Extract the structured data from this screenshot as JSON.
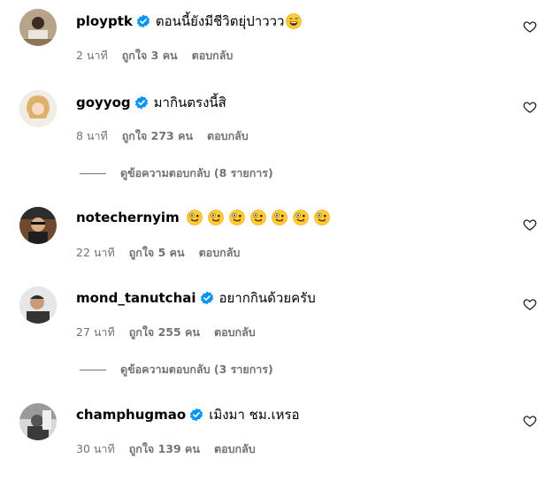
{
  "comments": [
    {
      "username": "ployptk",
      "verified": true,
      "text": "ตอนนี้ยังมีชีวิตยุ่ปาววว",
      "emoji_icons": [
        "laughing-sweat-emoji"
      ],
      "time": "2 นาที",
      "likes": "ถูกใจ 3 คน",
      "reply": "ตอบกลับ",
      "view_replies": ""
    },
    {
      "username": "goyyog",
      "verified": true,
      "text": "มากินตรงนี้สิ",
      "emoji_icons": [],
      "time": "8 นาที",
      "likes": "ถูกใจ 273 คน",
      "reply": "ตอบกลับ",
      "view_replies": "ดูข้อความตอบกลับ (8 รายการ)"
    },
    {
      "username": "notechernyim",
      "verified": false,
      "text": "",
      "emoji_icons": [
        "zany-face-emoji",
        "zany-face-emoji",
        "zany-face-emoji",
        "zany-face-emoji",
        "zany-face-emoji",
        "zany-face-emoji",
        "zany-face-emoji"
      ],
      "time": "22 นาที",
      "likes": "ถูกใจ 5 คน",
      "reply": "ตอบกลับ",
      "view_replies": ""
    },
    {
      "username": "mond_tanutchai",
      "verified": true,
      "text": "อยากกินด้วยครับ",
      "emoji_icons": [],
      "time": "27 นาที",
      "likes": "ถูกใจ 255 คน",
      "reply": "ตอบกลับ",
      "view_replies": "ดูข้อความตอบกลับ (3 รายการ)"
    },
    {
      "username": "champhugmao",
      "verified": true,
      "text": "เมิงมา ชม.เหรอ",
      "emoji_icons": [],
      "time": "30 นาที",
      "likes": "ถูกใจ 139 คน",
      "reply": "ตอบกลับ",
      "view_replies": ""
    }
  ],
  "colors": {
    "verified": "#0095f6",
    "meta": "#737373",
    "text": "#000000"
  },
  "icons": {
    "like": "heart-outline-icon",
    "verified": "verified-badge-icon"
  }
}
